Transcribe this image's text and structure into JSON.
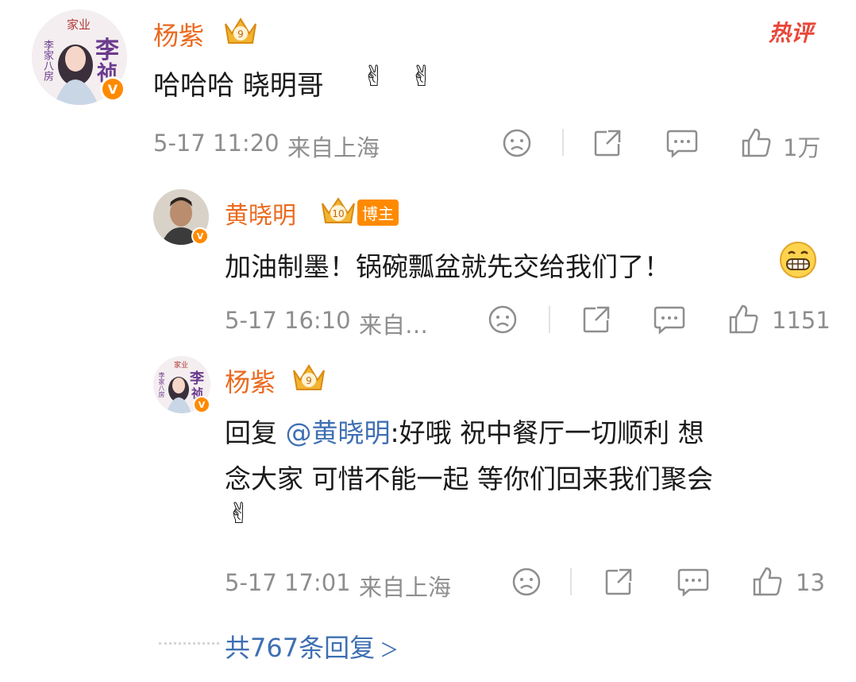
{
  "post_tag": {
    "label": "热评"
  },
  "comments": [
    {
      "author": "杨紫",
      "level": "9",
      "avatar_text": {
        "top": "家业",
        "big": "李",
        "big2": "祯",
        "side": "李家八房"
      },
      "text": "哈哈哈 晓明哥",
      "meta": {
        "date": "5-17 11:20",
        "location": "来自上海",
        "likes": "1万"
      }
    }
  ],
  "replies": [
    {
      "author": "黄晓明",
      "level": "10",
      "badge": "博主",
      "text": "加油制墨！锅碗瓢盆就先交给我们了！",
      "meta": {
        "date": "5-17 16:10",
        "location": "来自…",
        "likes": "1151"
      }
    },
    {
      "author": "杨紫",
      "level": "9",
      "avatar_text": {
        "top": "家业",
        "big": "李",
        "big2": "祯",
        "side": "李家八房"
      },
      "reply_prefix": "回复 ",
      "mention": "@黄晓明",
      "text_line1": ":好哦 祝中餐厅一切顺利 想",
      "text_line2": "念大家 可惜不能一起 等你们回来我们聚会",
      "meta": {
        "date": "5-17 17:01",
        "location": "来自上海",
        "likes": "13"
      }
    }
  ],
  "more_replies": {
    "label": "共767条回复",
    "chevron": "＞"
  },
  "colors": {
    "name": "#ea6a1f",
    "mention": "#3f6fb3",
    "meta": "#8e8e8e",
    "hot": "#e8473a",
    "verified": "#ff8a00"
  }
}
